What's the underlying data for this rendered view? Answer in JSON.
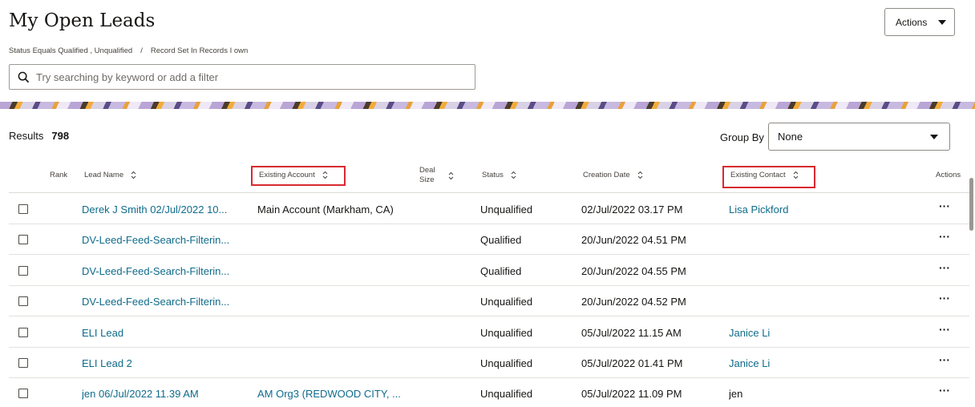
{
  "header": {
    "title": "My Open Leads",
    "actions_label": "Actions"
  },
  "filters": {
    "status": "Status Equals Qualified , Unqualified",
    "separator": "/",
    "record_set": "Record Set In Records I own"
  },
  "search": {
    "placeholder": "Try searching by keyword or add a filter"
  },
  "results": {
    "label": "Results",
    "count": "798"
  },
  "group_by": {
    "label": "Group By",
    "value": "None"
  },
  "table": {
    "columns": {
      "rank": "Rank",
      "lead_name": "Lead Name",
      "existing_account": "Existing Account",
      "deal_size_1": "Deal",
      "deal_size_2": "Size",
      "status": "Status",
      "creation_date": "Creation Date",
      "existing_contact": "Existing Contact",
      "actions": "Actions"
    },
    "rows": [
      {
        "lead_name": "Derek J Smith 02/Jul/2022 10...",
        "account": "Main Account (Markham, CA)",
        "status": "Unqualified",
        "created": "02/Jul/2022 03.17 PM",
        "contact": "Lisa Pickford"
      },
      {
        "lead_name": "DV-Leed-Feed-Search-Filterin...",
        "account": "",
        "status": "Qualified",
        "created": "20/Jun/2022 04.51 PM",
        "contact": ""
      },
      {
        "lead_name": "DV-Leed-Feed-Search-Filterin...",
        "account": "",
        "status": "Qualified",
        "created": "20/Jun/2022 04.55 PM",
        "contact": ""
      },
      {
        "lead_name": "DV-Leed-Feed-Search-Filterin...",
        "account": "",
        "status": "Unqualified",
        "created": "20/Jun/2022 04.52 PM",
        "contact": ""
      },
      {
        "lead_name": "ELI Lead",
        "account": "",
        "status": "Unqualified",
        "created": "05/Jul/2022 11.15 AM",
        "contact": "Janice Li"
      },
      {
        "lead_name": "ELI Lead 2",
        "account": "",
        "status": "Unqualified",
        "created": "05/Jul/2022 01.41 PM",
        "contact": "Janice Li"
      },
      {
        "lead_name": "jen 06/Jul/2022 11.39 AM",
        "account": "AM Org3 (REDWOOD CITY, ...",
        "status": "Unqualified",
        "created": "05/Jul/2022 11.09 PM",
        "contact": "jen"
      }
    ],
    "row_action_glyph": "···"
  },
  "colors": {
    "link": "#0f6b8a",
    "highlight": "#d8292f"
  }
}
